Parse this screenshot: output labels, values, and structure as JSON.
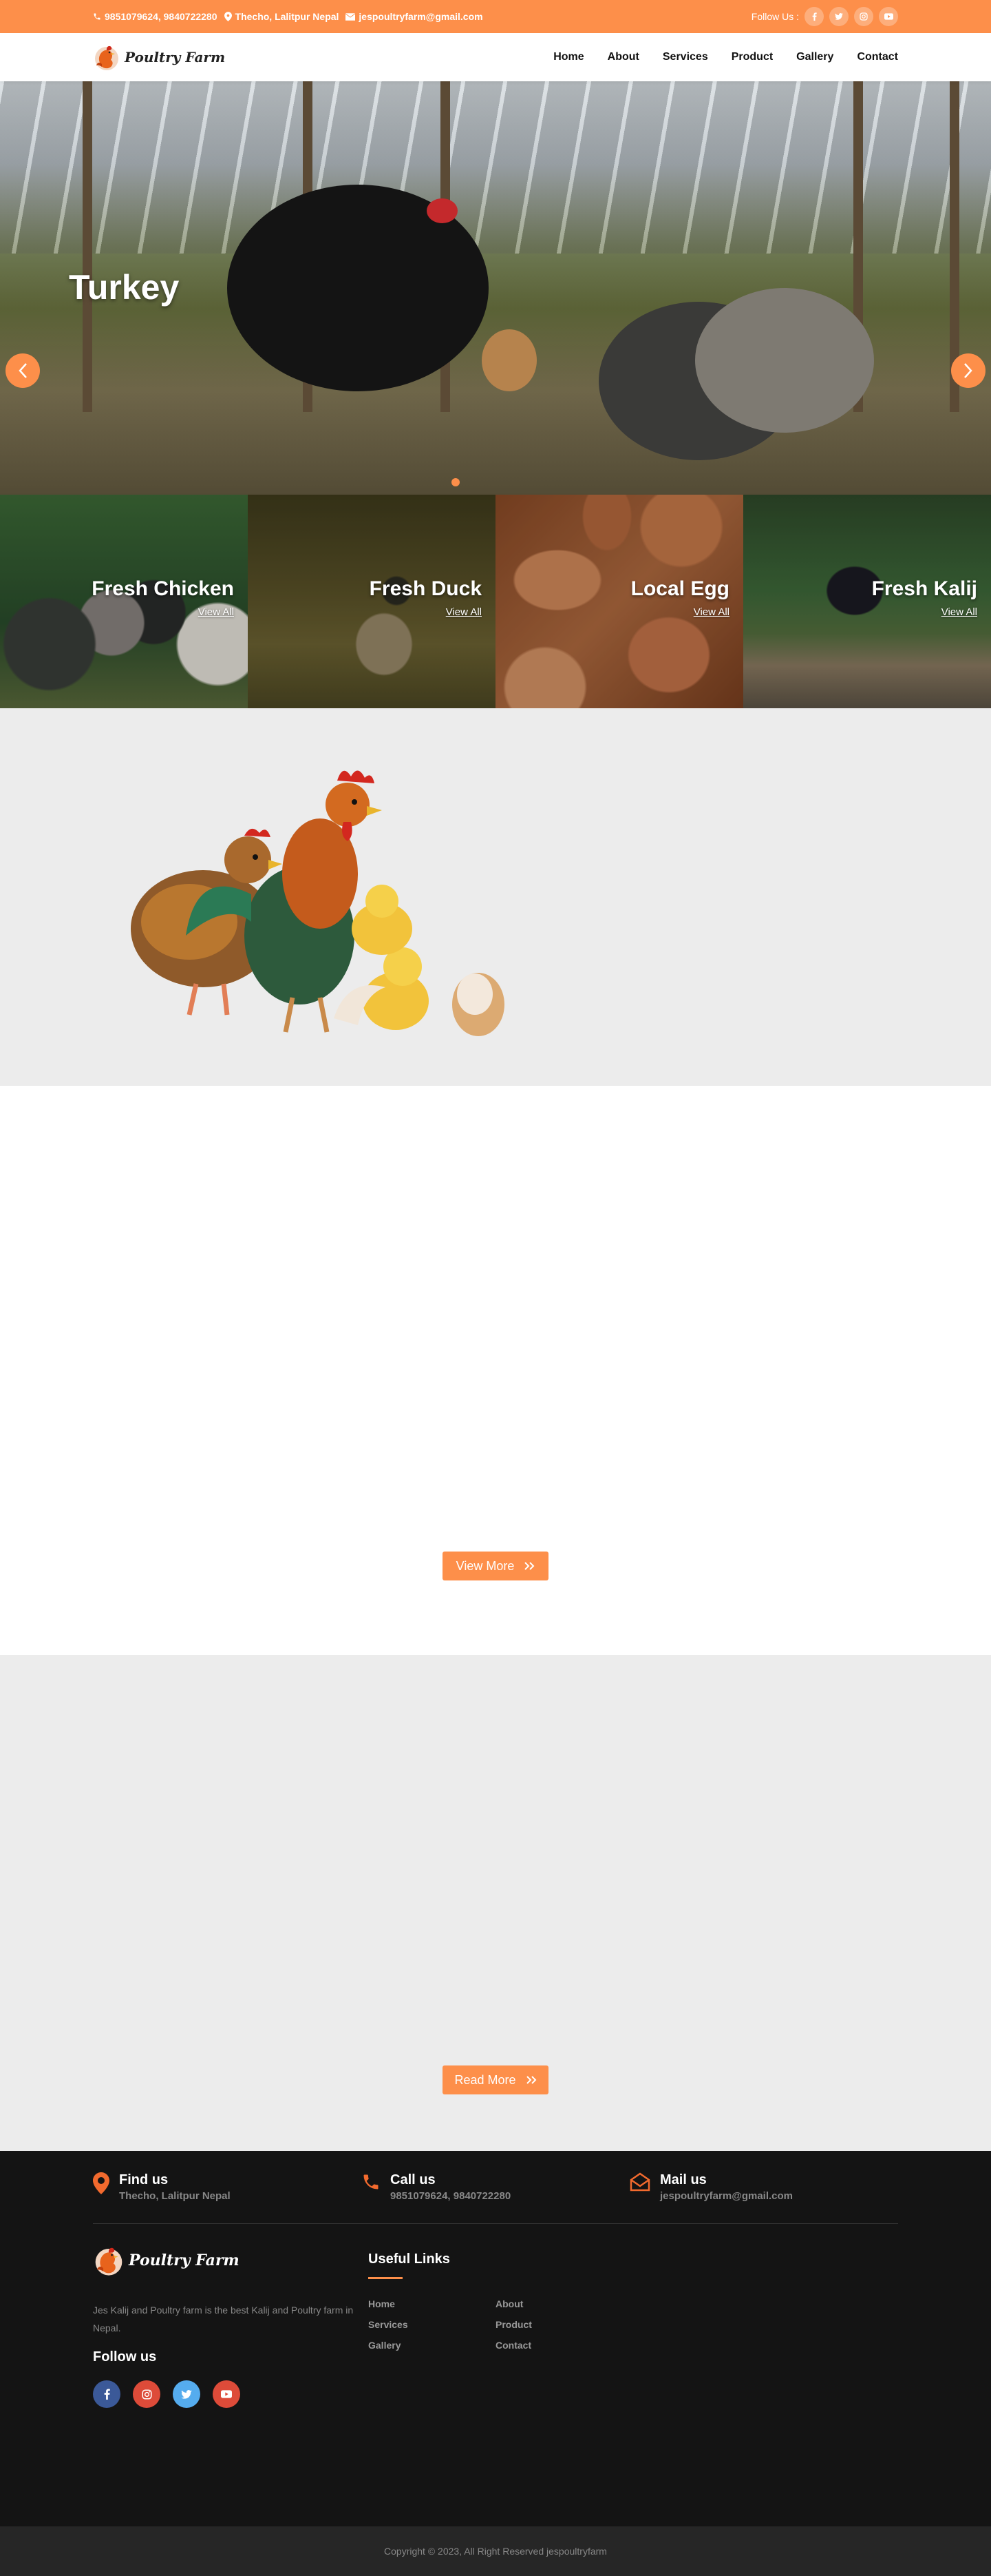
{
  "topbar": {
    "phone": "9851079624, 9840722280",
    "address": "Thecho, Lalitpur Nepal",
    "email": "jespoultryfarm@gmail.com",
    "follow_label": "Follow Us :",
    "socials": [
      "facebook-icon",
      "twitter-icon",
      "instagram-icon",
      "youtube-icon"
    ]
  },
  "nav": {
    "logo_text": "Poultry Farm",
    "items": [
      "Home",
      "About",
      "Services",
      "Product",
      "Gallery",
      "Contact"
    ]
  },
  "hero": {
    "title": "Turkey"
  },
  "categories": [
    {
      "title": "Fresh Chicken",
      "link": "View All"
    },
    {
      "title": "Fresh Duck",
      "link": "View All"
    },
    {
      "title": "Local Egg",
      "link": "View All"
    },
    {
      "title": "Fresh Kalij",
      "link": "View All"
    }
  ],
  "products": {
    "button": "View More"
  },
  "gallery": {
    "button": "Read More"
  },
  "footer": {
    "contacts": [
      {
        "title": "Find us",
        "value": "Thecho, Lalitpur Nepal",
        "icon": "map-pin-icon"
      },
      {
        "title": "Call us",
        "value": "9851079624, 9840722280",
        "icon": "phone-icon"
      },
      {
        "title": "Mail us",
        "value": "jespoultryfarm@gmail.com",
        "icon": "envelope-icon"
      }
    ],
    "logo_text": "Poultry Farm",
    "description": "Jes Kalij and Poultry farm is the best Kalij and Poultry farm in Nepal.",
    "follow_title": "Follow us",
    "socials": [
      {
        "icon": "facebook-icon",
        "color": "#3b5998"
      },
      {
        "icon": "instagram-icon",
        "color": "#dd4b39"
      },
      {
        "icon": "twitter-icon",
        "color": "#55acee"
      },
      {
        "icon": "youtube-icon",
        "color": "#dd4b39"
      }
    ],
    "links_title": "Useful Links",
    "links": [
      "Home",
      "About",
      "Services",
      "Product",
      "Gallery",
      "Contact"
    ],
    "copyright": "Copyright © 2023, All Right Reserved jespoultryfarm"
  },
  "colors": {
    "accent": "#fd8f4a",
    "footer_bg": "#141414",
    "section_gray": "#ececec"
  }
}
